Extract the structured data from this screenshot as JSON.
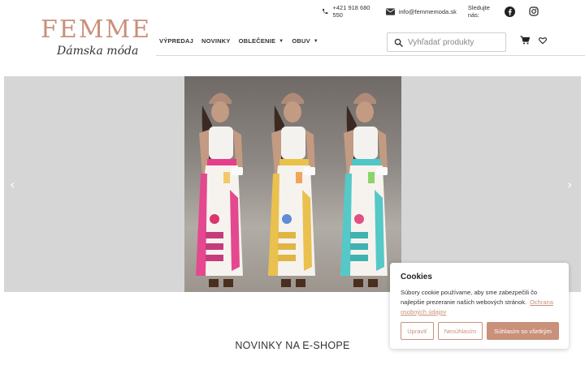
{
  "logo": {
    "main": "FEMME",
    "sub": "Dámska móda"
  },
  "topbar": {
    "phone": "+421 918 680 550",
    "email": "info@femmemoda.sk",
    "follow_label": "Sledujte nás:",
    "socials": [
      "facebook-icon",
      "instagram-icon"
    ]
  },
  "nav": {
    "items": [
      {
        "label": "VÝPREDAJ",
        "dropdown": false
      },
      {
        "label": "NOVINKY",
        "dropdown": false
      },
      {
        "label": "OBLEČENIE",
        "dropdown": true
      },
      {
        "label": "OBUV",
        "dropdown": true
      }
    ]
  },
  "search": {
    "placeholder": "Vyhľadať produkty"
  },
  "hero": {
    "prev": "‹",
    "next": "›"
  },
  "section": {
    "title": "NOVINKY NA E-SHOPE"
  },
  "cookies": {
    "title": "Cookies",
    "text": "Súbory cookie používame, aby sme zabezpečili čo najlepšie prezeranie našich webových stránok.",
    "link": "Ochrana osobných údajov",
    "buttons": {
      "adjust": "Upraviť",
      "decline": "Nesúhlasím",
      "accept": "Súhlasím so všetkým"
    }
  },
  "colors": {
    "accent": "#c9907a",
    "hero_bg": "#d6d6d6"
  }
}
